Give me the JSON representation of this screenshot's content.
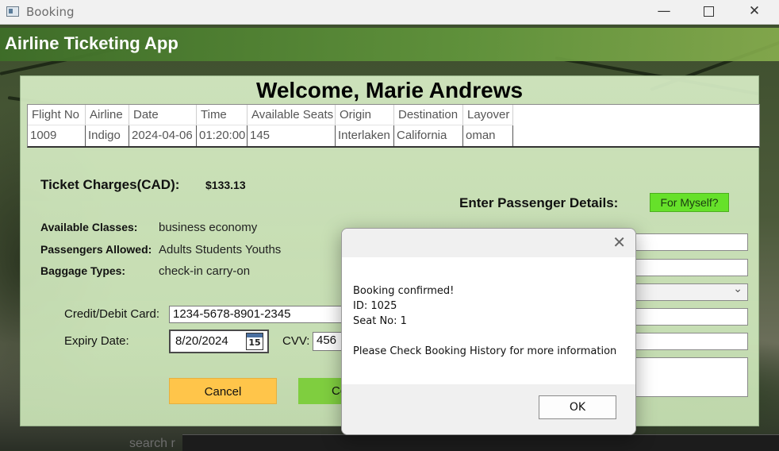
{
  "window": {
    "title": "Booking",
    "minimize": "—",
    "close": "✕"
  },
  "app": {
    "title": "Airline Ticketing App"
  },
  "welcome": "Welcome, Marie Andrews",
  "flights": {
    "columns": [
      "Flight No",
      "Airline",
      "Date",
      "Time",
      "Available Seats",
      "Origin",
      "Destination",
      "Layover"
    ],
    "rows": [
      [
        "1009",
        "Indigo",
        "2024-04-06",
        "01:20:00",
        "145",
        "Interlaken",
        "California",
        "oman"
      ]
    ]
  },
  "ticket": {
    "label": "Ticket Charges(CAD):",
    "value": "$133.13"
  },
  "details": {
    "classes_label": "Available Classes:",
    "classes_value": "business economy",
    "passengers_label": "Passengers Allowed:",
    "passengers_value": "Adults Students Youths",
    "baggage_label": "Baggage Types:",
    "baggage_value": "check-in carry-on"
  },
  "payment": {
    "card_label": "Credit/Debit Card:",
    "card_value": "1234-5678-8901-2345",
    "expiry_label": "Expiry Date:",
    "expiry_value": "8/20/2024",
    "calendar_day": "15",
    "cvv_label": "CVV:",
    "cvv_value": "456"
  },
  "buttons": {
    "cancel": "Cancel",
    "confirm": "Co",
    "for_myself": "For Myself?"
  },
  "passenger": {
    "heading": "Enter Passenger Details:"
  },
  "background": {
    "search_ghost": "search r"
  },
  "dialog": {
    "line1": "Booking confirmed!",
    "line2": "ID: 1025",
    "line3": "Seat No: 1",
    "line4": "Please Check Booking History for more information",
    "ok": "OK",
    "close": "✕"
  },
  "colors": {
    "header_green": "#5a9a38",
    "cancel_yellow": "#ffc54a",
    "confirm_green": "#7fce3f",
    "myself_green": "#66e12a"
  }
}
